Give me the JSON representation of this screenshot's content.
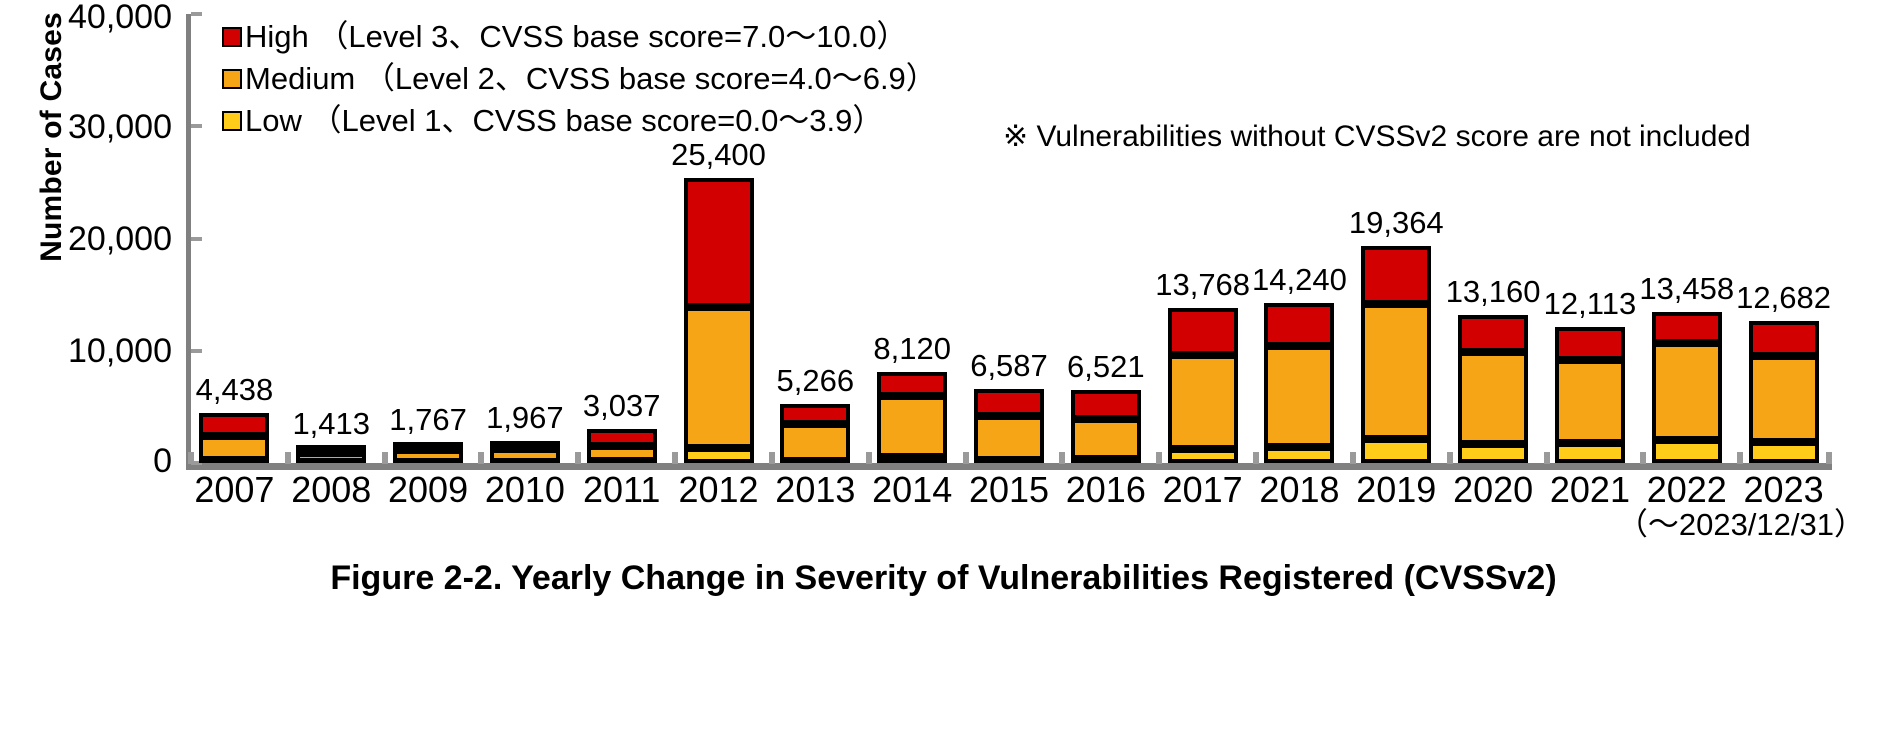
{
  "axis": {
    "y_title": "Number of Cases",
    "y_ticks": [
      "40,000",
      "30,000",
      "20,000",
      "10,000",
      "0"
    ]
  },
  "legend": {
    "items": [
      {
        "key": "high",
        "swatch": "legend-swatch-high",
        "label": "High （Level 3、CVSS base score=7.0～10.0）"
      },
      {
        "key": "medium",
        "swatch": "legend-swatch-medium",
        "label": "Medium （Level 2、CVSS base score=4.0～6.9）"
      },
      {
        "key": "low",
        "swatch": "legend-swatch-low",
        "label": "Low （Level 1、CVSS base score=0.0～3.9）"
      }
    ]
  },
  "note": "※ Vulnerabilities without CVSSv2 score are not included",
  "period": "（～2023/12/31）",
  "caption": "Figure 2-2. Yearly Change in Severity of Vulnerabilities Registered (CVSSv2)",
  "colors": {
    "high": "#D20000",
    "medium": "#F5A515",
    "low": "#FFCC19",
    "axis": "#808080",
    "outline": "#000000"
  },
  "chart_data": {
    "type": "bar",
    "subtype": "stacked",
    "title": "Figure 2-2. Yearly Change in Severity of Vulnerabilities Registered (CVSSv2)",
    "xlabel": "",
    "ylabel": "Number of Cases",
    "ylim": [
      0,
      40000
    ],
    "yticks": [
      0,
      10000,
      20000,
      30000,
      40000
    ],
    "grid": false,
    "legend_position": "top-left",
    "categories": [
      "2007",
      "2008",
      "2009",
      "2010",
      "2011",
      "2012",
      "2013",
      "2014",
      "2015",
      "2016",
      "2017",
      "2018",
      "2019",
      "2020",
      "2021",
      "2022",
      "2023"
    ],
    "series": [
      {
        "name": "Low",
        "color": "#FFCC19",
        "values": [
          280,
          120,
          110,
          120,
          140,
          1320,
          220,
          530,
          300,
          320,
          1280,
          1430,
          2120,
          1710,
          1760,
          2060,
          1830
        ]
      },
      {
        "name": "Medium",
        "color": "#F5A515",
        "values": [
          2100,
          760,
          1060,
          1100,
          1350,
          12600,
          3220,
          5450,
          3850,
          3620,
          8380,
          9000,
          12050,
          8200,
          7420,
          8600,
          7700
        ]
      },
      {
        "name": "High",
        "color": "#D20000",
        "values": [
          2058,
          533,
          597,
          747,
          1547,
          11480,
          1826,
          2140,
          2437,
          2581,
          4108,
          3810,
          5194,
          3250,
          2933,
          2798,
          3152
        ]
      }
    ],
    "totals": [
      4438,
      1413,
      1767,
      1967,
      3037,
      25400,
      5266,
      8120,
      6587,
      6521,
      13768,
      14240,
      19364,
      13160,
      12113,
      13458,
      12682
    ],
    "total_labels": [
      "4,438",
      "1,413",
      "1,767",
      "1,967",
      "3,037",
      "25,400",
      "5,266",
      "8,120",
      "6,587",
      "6,521",
      "13,768",
      "14,240",
      "19,364",
      "13,160",
      "12,113",
      "13,458",
      "12,682"
    ],
    "annotations": [
      "※ Vulnerabilities without CVSSv2 score are not included",
      "（～2023/12/31）"
    ]
  }
}
